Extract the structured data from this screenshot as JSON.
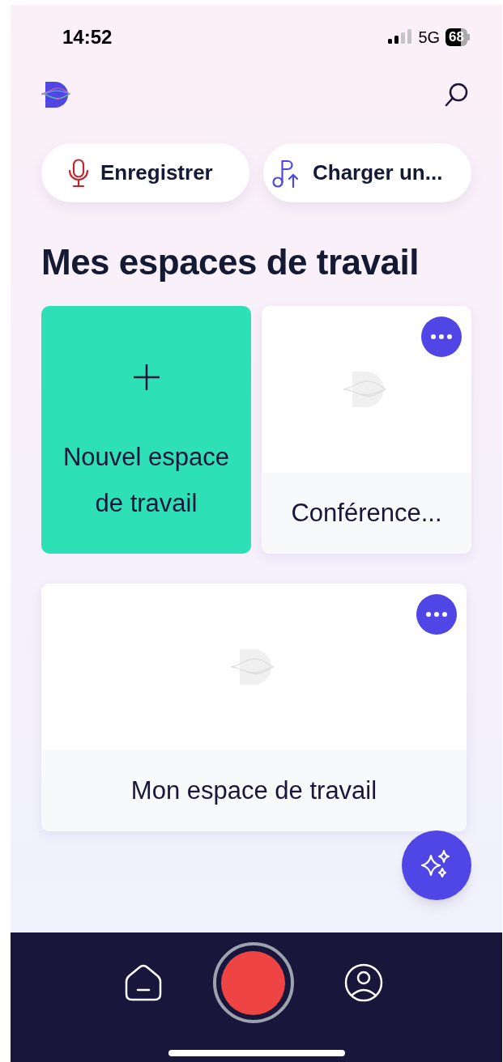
{
  "status_bar": {
    "time": "14:52",
    "network": "5G",
    "battery": "68"
  },
  "actions": [
    {
      "kind": "record",
      "label": "Enregistrer"
    },
    {
      "kind": "upload",
      "label": "Charger un..."
    }
  ],
  "title": "Mes espaces de travail",
  "workspaces": [
    {
      "kind": "new",
      "label": "Nouvel espace de travail"
    },
    {
      "kind": "workspace",
      "label": "Conférence..."
    },
    {
      "kind": "workspace",
      "label": "Mon espace de travail"
    }
  ],
  "nav": [
    {
      "kind": "home"
    },
    {
      "kind": "record"
    },
    {
      "kind": "profile"
    }
  ]
}
